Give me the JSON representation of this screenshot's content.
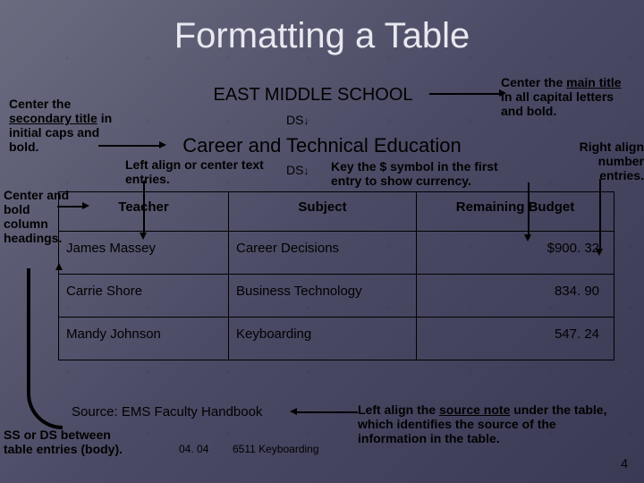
{
  "slide": {
    "title": "Formatting a Table",
    "main_title": "EAST MIDDLE SCHOOL",
    "ds_label": "DS",
    "secondary_title": "Career and Technical Education",
    "source_note": "Source:  EMS Faculty Handbook",
    "footer_date": "04. 04",
    "footer_course": "6511  Keyboarding",
    "page_number": "4"
  },
  "callouts": {
    "main": {
      "pre": "Center the ",
      "ul": "main title",
      "post": " in all capital letters and bold."
    },
    "sec": {
      "pre": "Center the ",
      "ul": "secondary title",
      "post": " in initial caps and bold."
    },
    "left": "Left align or center text entries.",
    "key": "Key the $ symbol in the first entry to show currency.",
    "right": "Right align number entries.",
    "cols": "Center and bold column headings.",
    "ss": "SS or DS between table entries (body).",
    "source": {
      "pre": "Left align the ",
      "ul": "source note",
      "post": " under the table, which identifies the source of the information in the table."
    }
  },
  "table": {
    "headers": [
      "Teacher",
      "Subject",
      "Remaining Budget"
    ],
    "rows": [
      {
        "teacher": "James Massey",
        "subject": "Career Decisions",
        "budget": "$900. 32"
      },
      {
        "teacher": "Carrie Shore",
        "subject": "Business Technology",
        "budget": "834. 90"
      },
      {
        "teacher": "Mandy Johnson",
        "subject": "Keyboarding",
        "budget": "547. 24"
      }
    ]
  }
}
